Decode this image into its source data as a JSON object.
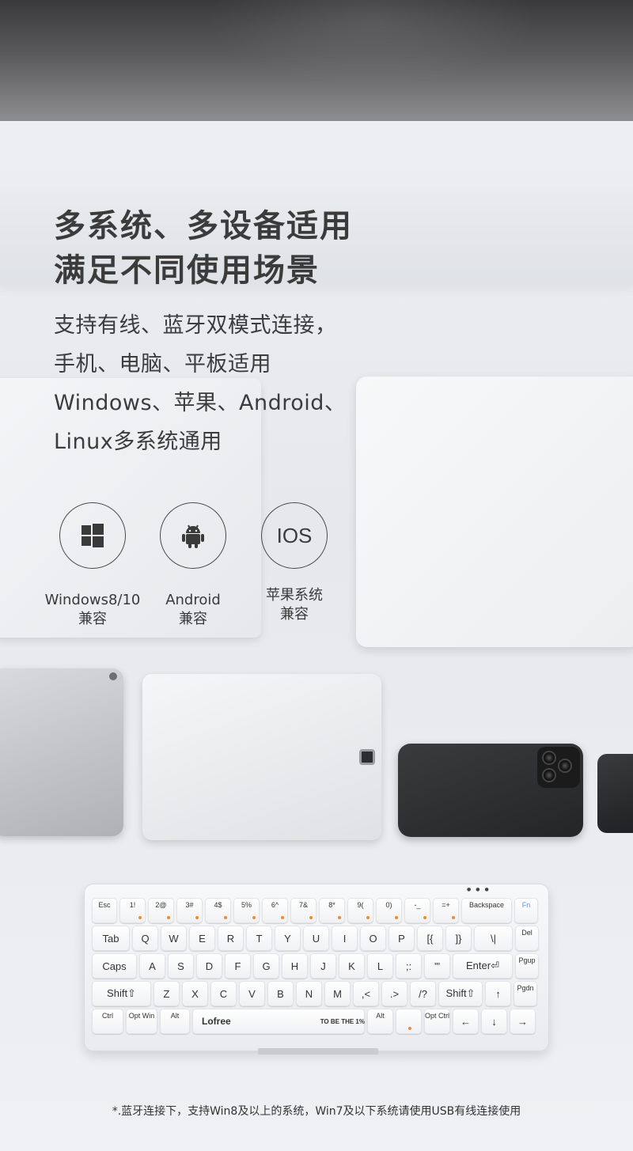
{
  "headline": {
    "line1": "多系统、多设备适用",
    "line2": "满足不同使用场景"
  },
  "description": {
    "line1": "支持有线、蓝牙双模式连接，",
    "line2": "手机、电脑、平板适用",
    "line3": "Windows、苹果、Android、",
    "line4": "Linux多系统通用"
  },
  "os_support": [
    {
      "icon": "windows-icon",
      "label1": "Windows8/10",
      "label2": "兼容"
    },
    {
      "icon": "android-icon",
      "label1": "Android",
      "label2": "兼容"
    },
    {
      "icon": "ios-icon",
      "icon_text": "IOS",
      "label1": "苹果系统",
      "label2": "兼容"
    }
  ],
  "keyboard": {
    "brand": "Lofree",
    "space_tag": "TO BE THE 1%",
    "rows": [
      [
        "Esc",
        "1!",
        "2@",
        "3#",
        "4$",
        "5%",
        "6^",
        "7&",
        "8*",
        "9(",
        "0)",
        "-_",
        "=+",
        "Backspace",
        "Fn"
      ],
      [
        "Tab",
        "Q",
        "W",
        "E",
        "R",
        "T",
        "Y",
        "U",
        "I",
        "O",
        "P",
        "[{",
        "]}",
        "\\|",
        "Del"
      ],
      [
        "Caps",
        "A",
        "S",
        "D",
        "F",
        "G",
        "H",
        "J",
        "K",
        "L",
        ";:",
        "'\"",
        "Enter⏎",
        "Pgup"
      ],
      [
        "Shift⇧",
        "Z",
        "X",
        "C",
        "V",
        "B",
        "N",
        "M",
        ",<",
        ".>",
        "/?",
        "Shift⇧",
        "↑",
        "Pgdn"
      ],
      [
        "Ctrl",
        "Opt Win",
        "Alt",
        "Lofree",
        "Alt",
        "",
        "Opt Ctrl",
        "←",
        "↓",
        "→"
      ]
    ]
  },
  "footnote": "*.蓝牙连接下，支持Win8及以上的系统，Win7及以下系统请使用USB有线连接使用",
  "colors": {
    "accent_dot": "#f08a34",
    "text": "#3b3b3b",
    "background": "#eef0f3"
  }
}
